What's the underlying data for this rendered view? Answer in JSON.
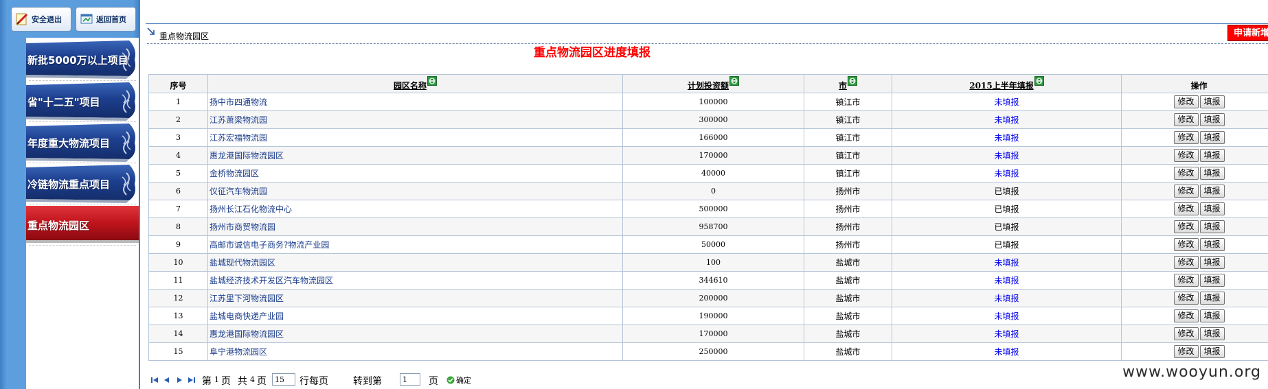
{
  "header": {
    "logout_label": "安全退出",
    "home_label": "返回首页"
  },
  "sidebar": {
    "items": [
      {
        "label": "新批5000万以上项目",
        "active": false
      },
      {
        "label": "省\"十二五\"项目",
        "active": false
      },
      {
        "label": "年度重大物流项目",
        "active": false
      },
      {
        "label": "冷链物流重点项目",
        "active": false
      },
      {
        "label": "重点物流园区",
        "active": true
      }
    ]
  },
  "breadcrumb": {
    "text": "重点物流园区"
  },
  "apply_button": {
    "label": "申请新增"
  },
  "page_title": "重点物流园区进度填报",
  "table": {
    "columns": {
      "seq": "序号",
      "name": "园区名称",
      "investment": "计划投资额",
      "city": "市",
      "report": "2015上半年填报",
      "ops": "操作"
    },
    "edit_label": "修改",
    "fill_label": "填报",
    "rows": [
      {
        "seq": "1",
        "name": "扬中市四通物流",
        "investment": "100000",
        "city": "镇江市",
        "status": "未填报"
      },
      {
        "seq": "2",
        "name": "江苏萧梁物流园",
        "investment": "300000",
        "city": "镇江市",
        "status": "未填报"
      },
      {
        "seq": "3",
        "name": "江苏宏福物流园",
        "investment": "166000",
        "city": "镇江市",
        "status": "未填报"
      },
      {
        "seq": "4",
        "name": "惠龙港国际物流园区",
        "investment": "170000",
        "city": "镇江市",
        "status": "未填报"
      },
      {
        "seq": "5",
        "name": "金桥物流园区",
        "investment": "40000",
        "city": "镇江市",
        "status": "未填报"
      },
      {
        "seq": "6",
        "name": "仪征汽车物流园",
        "investment": "0",
        "city": "扬州市",
        "status": "已填报"
      },
      {
        "seq": "7",
        "name": "扬州长江石化物流中心",
        "investment": "500000",
        "city": "扬州市",
        "status": "已填报"
      },
      {
        "seq": "8",
        "name": "扬州市商贸物流园",
        "investment": "958700",
        "city": "扬州市",
        "status": "已填报"
      },
      {
        "seq": "9",
        "name": "高邮市诚信电子商务?物流产业园",
        "investment": "50000",
        "city": "扬州市",
        "status": "已填报"
      },
      {
        "seq": "10",
        "name": "盐城现代物流园区",
        "investment": "100",
        "city": "盐城市",
        "status": "未填报"
      },
      {
        "seq": "11",
        "name": "盐城经济技术开发区汽车物流园区",
        "investment": "344610",
        "city": "盐城市",
        "status": "未填报"
      },
      {
        "seq": "12",
        "name": "江苏里下河物流园区",
        "investment": "200000",
        "city": "盐城市",
        "status": "未填报"
      },
      {
        "seq": "13",
        "name": "盐城电商快递产业园",
        "investment": "190000",
        "city": "盐城市",
        "status": "未填报"
      },
      {
        "seq": "14",
        "name": "惠龙港国际物流园区",
        "investment": "170000",
        "city": "盐城市",
        "status": "未填报"
      },
      {
        "seq": "15",
        "name": "阜宁港物流园区",
        "investment": "250000",
        "city": "盐城市",
        "status": "未填报"
      }
    ]
  },
  "pager": {
    "label_page": "第",
    "current_page": "1",
    "label_page_unit": "页",
    "label_total": "共",
    "total_pages": "4",
    "label_total_unit": "页",
    "rows_per_page": "15",
    "label_rows_per_page": "行每页",
    "label_goto": "转到第",
    "goto_page": "1",
    "label_goto_unit": "页",
    "confirm_label": "确定"
  },
  "watermark": "www.wooyun.org",
  "colors": {
    "title_red": "#ff0000",
    "link_blue": "#1a3c8c",
    "pending_blue": "#0000ee",
    "sidebar_blue": "#5a9bdb",
    "active_tab_red": "#c0141c",
    "tab_navy": "#1d3f8f"
  }
}
